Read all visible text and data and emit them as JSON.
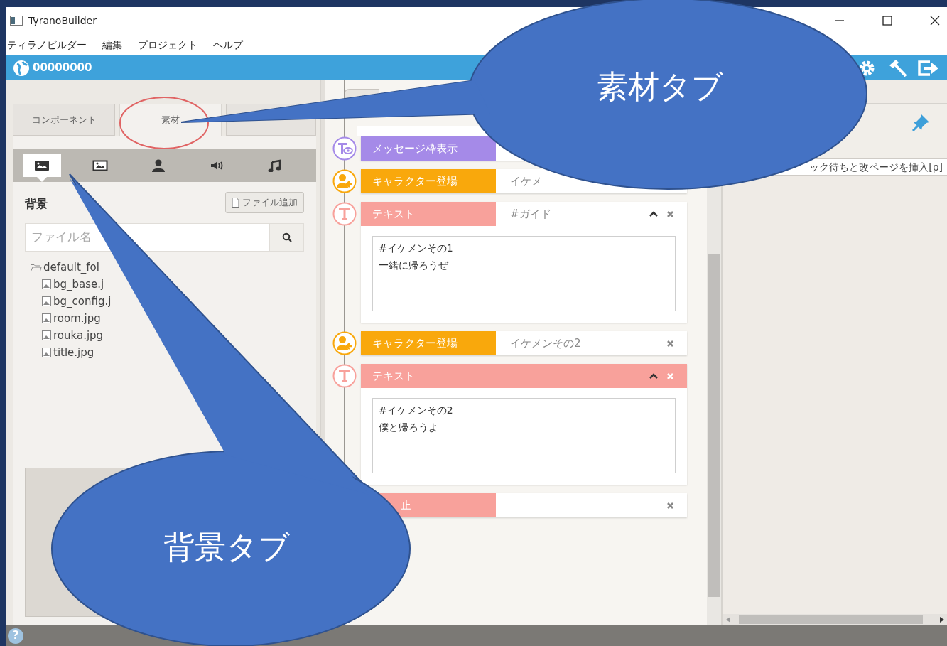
{
  "window": {
    "title": "TyranoBuilder"
  },
  "menu": [
    "ティラノビルダー",
    "編集",
    "プロジェクト",
    "ヘルプ"
  ],
  "toolbar": {
    "project": "00000000"
  },
  "left_panel": {
    "tabs": [
      {
        "label": "コンポーネント",
        "selected": false
      },
      {
        "label": "素材",
        "selected": true
      },
      {
        "selected": false
      }
    ],
    "asset_tabs": [
      {
        "kind": "background",
        "selected": true
      },
      {
        "kind": "image",
        "selected": false
      },
      {
        "kind": "character",
        "selected": false
      },
      {
        "kind": "sound",
        "selected": false
      },
      {
        "kind": "music",
        "selected": false
      }
    ],
    "section_title": "背景",
    "add_file_button": "ファイル追加",
    "search": {
      "placeholder": "ファイル名"
    },
    "tree": [
      {
        "label": "default_fol",
        "kind": "folder",
        "children": [
          {
            "label": "bg_base.j",
            "kind": "image"
          },
          {
            "label": "bg_config.j",
            "kind": "image"
          },
          {
            "label": "room.jpg",
            "kind": "image"
          },
          {
            "label": "rouka.jpg",
            "kind": "image"
          },
          {
            "label": "title.jpg",
            "kind": "image"
          }
        ]
      }
    ]
  },
  "timeline": [
    {
      "kind": "message",
      "label": "メッセージ枠表示",
      "color": "#a58ae8",
      "selected": false
    },
    {
      "kind": "character",
      "label": "キャラクター登場",
      "color": "#f9a80c",
      "value": "イケメ",
      "selected": false
    },
    {
      "kind": "text",
      "label": "テキスト",
      "color": "#f8a19b",
      "value": "#ガイド",
      "selected": false,
      "expanded": true,
      "body": "#イケメンその1\n一緒に帰ろうぜ"
    },
    {
      "kind": "character",
      "label": "キャラクター登場",
      "color": "#f9a80c",
      "value": "イケメンその2",
      "selected": false
    },
    {
      "kind": "text",
      "label": "テキスト",
      "color": "#f8a19b",
      "selected": true,
      "expanded": true,
      "body": "#イケメンその2\n僕と帰ろうよ"
    },
    {
      "kind": "stop",
      "label": "止",
      "color": "#f8a19b",
      "selected": false
    }
  ],
  "right_panel": {
    "text": "ック待ちと改ページを挿入[p]"
  },
  "status_bar": {
    "help": "?"
  },
  "annotations": [
    {
      "text": "素材タブ"
    },
    {
      "text": "背景タブ"
    }
  ]
}
